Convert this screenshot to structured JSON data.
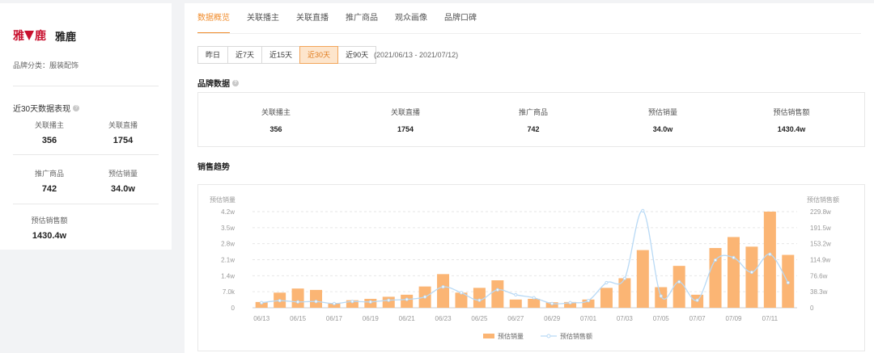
{
  "brand": {
    "logo_text_1": "雅",
    "logo_text_2": "鹿",
    "name": "雅鹿",
    "category": "品牌分类：服装配饰"
  },
  "recent": {
    "title": "近30天数据表现",
    "stats": [
      {
        "label": "关联播主",
        "value": "356"
      },
      {
        "label": "关联直播",
        "value": "1754"
      },
      {
        "label": "推广商品",
        "value": "742"
      },
      {
        "label": "预估销量",
        "value": "34.0w"
      },
      {
        "label": "预估销售额",
        "value": "1430.4w"
      }
    ]
  },
  "tabs": [
    "数据概览",
    "关联播主",
    "关联直播",
    "推广商品",
    "观众画像",
    "品牌口碑"
  ],
  "active_tab": 0,
  "ranges": [
    "昨日",
    "近7天",
    "近15天",
    "近30天",
    "近90天"
  ],
  "active_range": 3,
  "date_range": "(2021/06/13 - 2021/07/12)",
  "brand_data": {
    "title": "品牌数据",
    "items": [
      {
        "label": "关联播主",
        "value": "356"
      },
      {
        "label": "关联直播",
        "value": "1754"
      },
      {
        "label": "推广商品",
        "value": "742"
      },
      {
        "label": "预估销量",
        "value": "34.0w"
      },
      {
        "label": "预估销售额",
        "value": "1430.4w"
      }
    ]
  },
  "sales_trend": {
    "title": "销售趋势"
  },
  "colors": {
    "accent": "#f08c2c",
    "bar": "#fbb574",
    "line": "#b8d9f5"
  },
  "chart_data": {
    "type": "bar",
    "categories": [
      "06/13",
      "06/14",
      "06/15",
      "06/16",
      "06/17",
      "06/18",
      "06/19",
      "06/20",
      "06/21",
      "06/22",
      "06/23",
      "06/24",
      "06/25",
      "06/26",
      "06/27",
      "06/28",
      "06/29",
      "06/30",
      "07/01",
      "07/02",
      "07/03",
      "07/04",
      "07/05",
      "07/06",
      "07/07",
      "07/08",
      "07/09",
      "07/10",
      "07/11",
      "07/12"
    ],
    "x_tick_labels": [
      "06/13",
      "06/15",
      "06/17",
      "06/19",
      "06/21",
      "06/23",
      "06/25",
      "06/27",
      "06/29",
      "07/01",
      "07/03",
      "07/05",
      "07/07",
      "07/09",
      "07/11"
    ],
    "series": [
      {
        "name": "预估销量",
        "type": "bar",
        "axis": "left",
        "values": [
          0.42,
          1.1,
          1.4,
          1.3,
          0.35,
          0.55,
          0.65,
          0.8,
          0.95,
          1.55,
          2.45,
          1.1,
          1.45,
          2.0,
          0.6,
          0.65,
          0.4,
          0.42,
          0.6,
          1.45,
          2.15,
          4.2,
          1.5,
          3.05,
          0.95,
          4.35,
          5.15,
          4.45,
          7.0,
          3.85
        ]
      },
      {
        "name": "预估销售额",
        "type": "line",
        "axis": "right",
        "values": [
          12,
          17,
          14,
          15,
          10,
          15,
          14,
          18,
          20,
          26,
          50,
          36,
          18,
          43,
          31,
          24,
          10,
          12,
          17,
          60,
          70,
          232,
          28,
          62,
          18,
          114,
          120,
          85,
          128,
          60
        ]
      }
    ],
    "ylabel_left": "预估销量",
    "ylabel_right": "预估销售额",
    "yticks_left": [
      "0",
      "7.0k",
      "1.4w",
      "2.1w",
      "2.8w",
      "3.5w",
      "4.2w"
    ],
    "yticks_right": [
      "0",
      "38.3w",
      "76.6w",
      "114.9w",
      "153.2w",
      "191.5w",
      "229.8w"
    ],
    "ylim_left": [
      0,
      7.0
    ],
    "ylim_right": [
      0,
      229.8
    ],
    "grid": true,
    "legend_position": "bottom"
  }
}
